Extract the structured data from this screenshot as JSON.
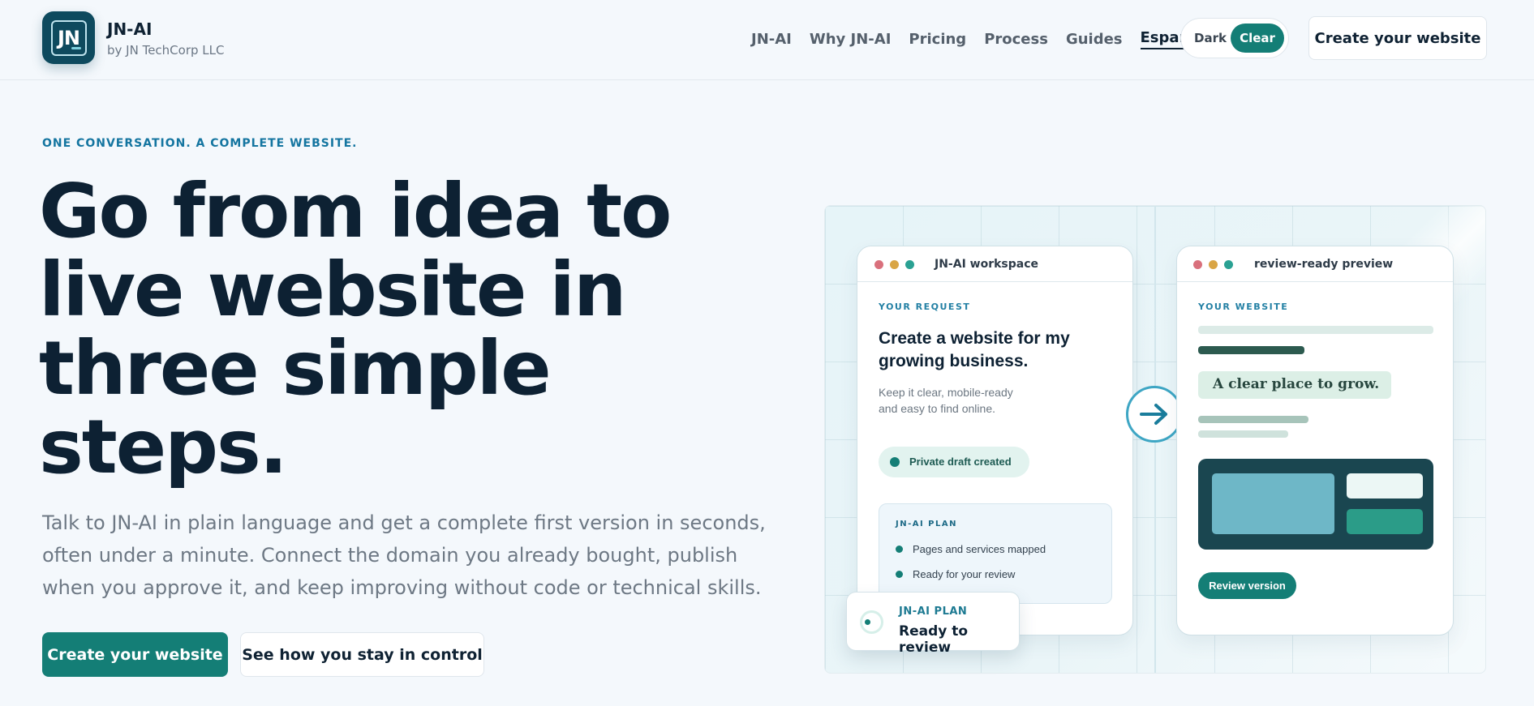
{
  "header": {
    "brand_name": "JN-AI",
    "brand_sub": "by JN TechCorp LLC",
    "logo_text": "JN",
    "nav": [
      {
        "label": "JN-AI"
      },
      {
        "label": "Why JN-AI"
      },
      {
        "label": "Pricing"
      },
      {
        "label": "Process"
      },
      {
        "label": "Guides"
      },
      {
        "label": "Español"
      }
    ],
    "theme_dark": "Dark",
    "theme_clear": "Clear",
    "cta": "Create your website"
  },
  "hero": {
    "eyebrow": "ONE CONVERSATION. A COMPLETE WEBSITE.",
    "headline": "Go from idea to live website in three simple steps.",
    "subtext": "Talk to JN-AI in plain language and get a complete first version in seconds, often under a minute. Connect the domain you already bought, publish when you approve it, and keep improving without code or technical skills.",
    "primary_cta": "Create your website",
    "secondary_cta": "See how you stay in control"
  },
  "workspace": {
    "title": "JN-AI workspace",
    "eyebrow": "YOUR REQUEST",
    "heading": "Create a website for my growing business.",
    "desc": "Keep it clear, mobile-ready and easy to find online.",
    "draft_pill": "Private draft created",
    "plan_title": "JN-AI PLAN",
    "plan_items": [
      "Pages and services mapped",
      "Ready for your review"
    ]
  },
  "floating_card": {
    "eyebrow": "JN-AI PLAN",
    "text": "Ready to review"
  },
  "preview": {
    "title": "review-ready preview",
    "eyebrow": "YOUR WEBSITE",
    "tagline": "A clear place to grow.",
    "review_button": "Review version"
  },
  "colors": {
    "accent": "#147e76",
    "dot_red": "#d9707c",
    "dot_amber": "#d9a545",
    "dot_teal": "#2aa193"
  }
}
